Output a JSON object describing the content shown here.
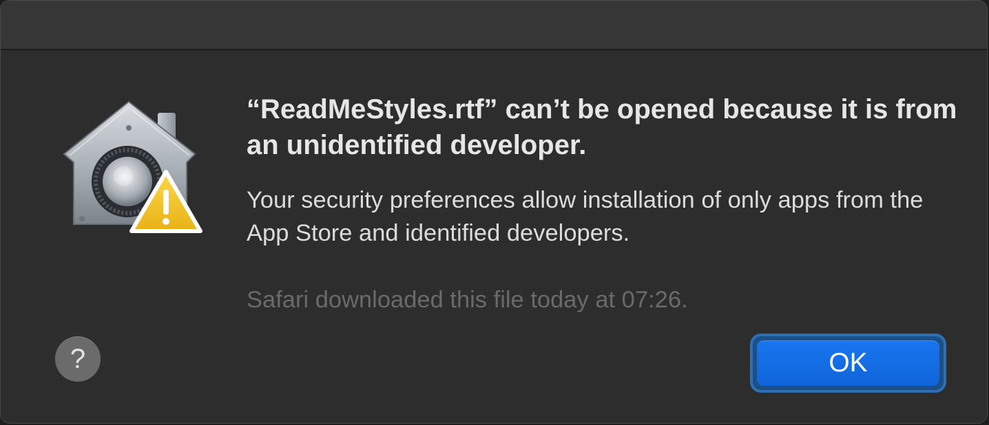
{
  "dialog": {
    "title": "“ReadMeStyles.rtf” can’t be opened because it is from an unidentified developer.",
    "message": "Your security preferences allow installation of only apps from the App Store and identified developers.",
    "info": "Safari downloaded this file today at 07:26.",
    "help_label": "?",
    "ok_label": "OK",
    "icon": "gatekeeper-warning-icon"
  },
  "colors": {
    "background": "#2d2d2d",
    "accent": "#0f64d9",
    "warning": "#f3c623"
  }
}
